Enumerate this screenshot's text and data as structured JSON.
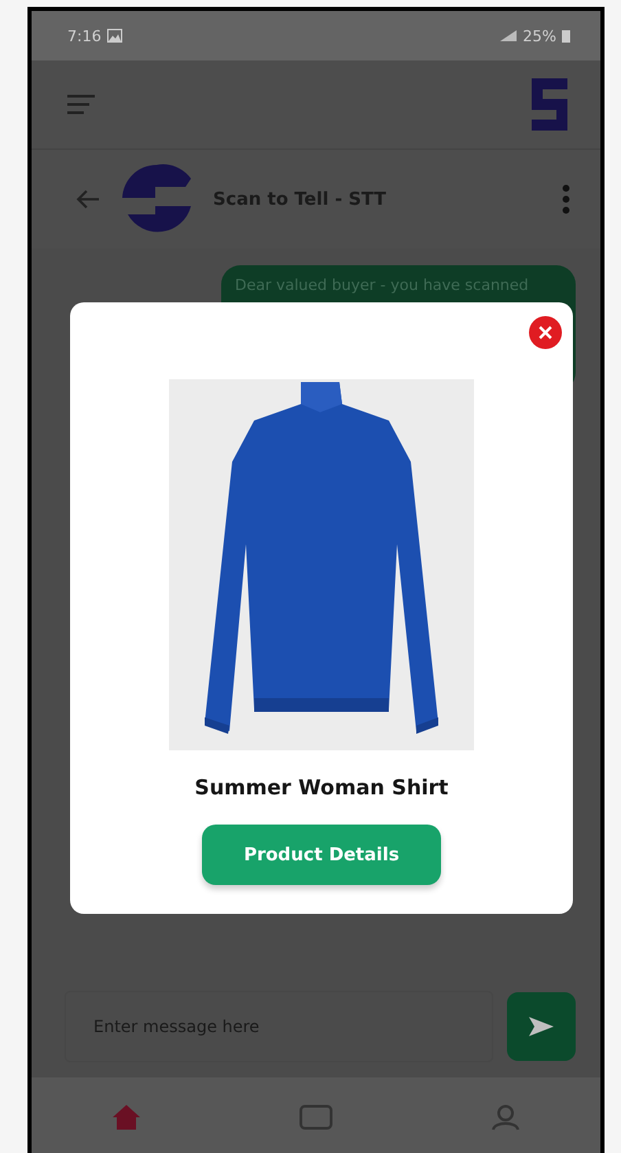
{
  "status_bar": {
    "time": "7:16",
    "battery": "25%"
  },
  "chat_header": {
    "title": "Scan to Tell - STT"
  },
  "messages": [
    {
      "text": "Dear valued buyer - you have scanned"
    }
  ],
  "product_popup": {
    "name": "Summer Woman Shirt",
    "button": "Product Details"
  },
  "composer": {
    "placeholder": "Enter message here"
  },
  "bottom_nav": [
    {
      "kind": "home",
      "selected": true
    },
    {
      "kind": "scan",
      "selected": false
    },
    {
      "kind": "profile",
      "selected": false
    }
  ]
}
